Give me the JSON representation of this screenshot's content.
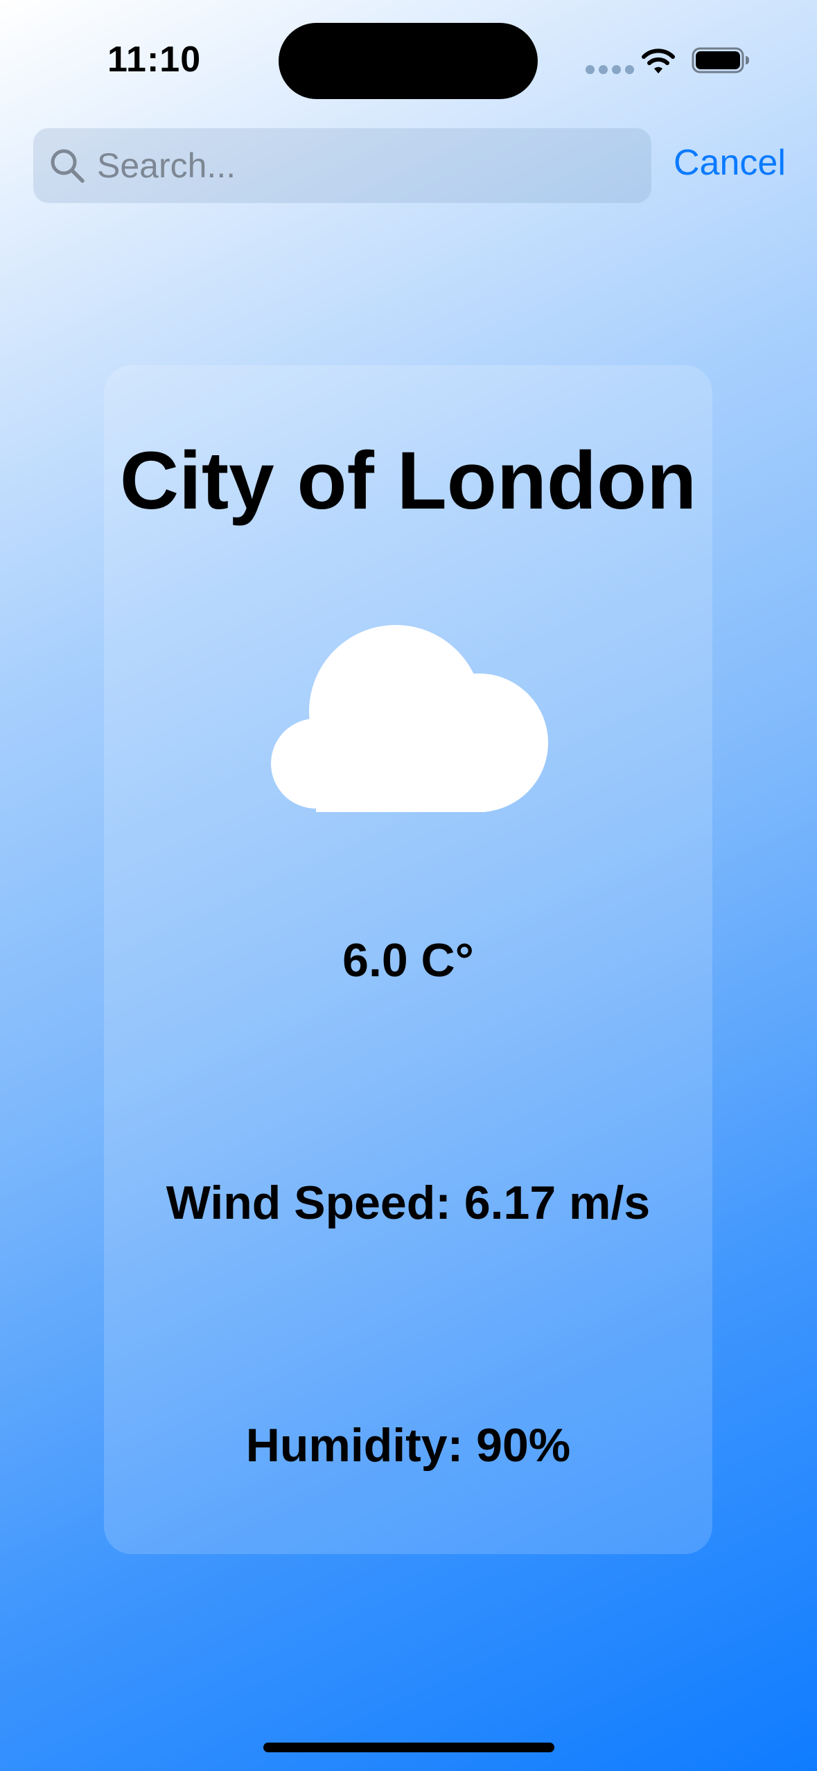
{
  "status_bar": {
    "time": "11:10"
  },
  "search": {
    "placeholder": "Search...",
    "value": "",
    "cancel_label": "Cancel"
  },
  "weather": {
    "city": "City of London",
    "condition_icon": "cloud-icon",
    "temperature": "6.0 C°",
    "wind_speed": "Wind Speed: 6.17 m/s",
    "humidity": "Humidity: 90%"
  },
  "colors": {
    "accent": "#0a7aff",
    "background_start": "#ffffff",
    "background_end": "#0f7cff",
    "text": "#000000"
  }
}
